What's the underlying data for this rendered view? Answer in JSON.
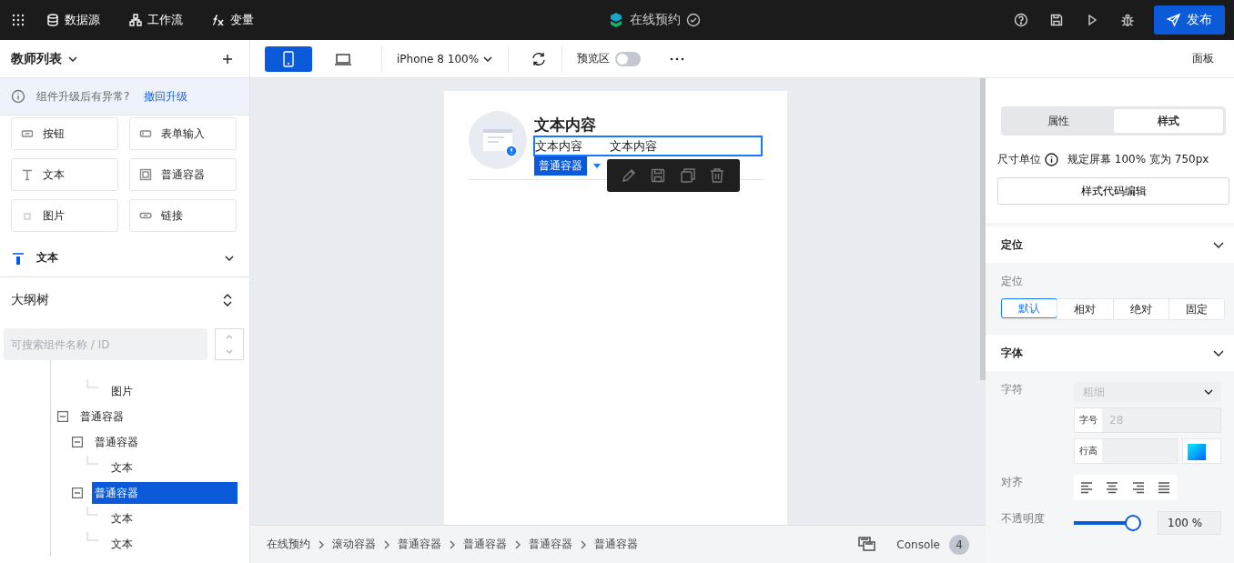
{
  "topbar": {
    "menu": [
      {
        "label": "数据源",
        "kind": "database"
      },
      {
        "label": "工作流",
        "kind": "flow"
      },
      {
        "label": "变量",
        "kind": "fx"
      }
    ],
    "app_title": "在线预约",
    "publish": "发布"
  },
  "toolbar": {
    "page_name": "教师列表",
    "devices": [
      {
        "kind": "phone",
        "selected": true
      },
      {
        "kind": "laptop",
        "selected": false
      }
    ],
    "device_select": "iPhone 8 100%",
    "preview_label": "预览区",
    "preview_on": false,
    "panel": "面板"
  },
  "left": {
    "notice": {
      "text": "组件升级后有异常?",
      "link": "撤回升级"
    },
    "components": [
      {
        "label": "按钮",
        "kind": "button"
      },
      {
        "label": "表单输入",
        "kind": "input"
      },
      {
        "label": "文本",
        "kind": "text"
      },
      {
        "label": "普通容器",
        "kind": "container"
      },
      {
        "label": "图片",
        "kind": "image"
      },
      {
        "label": "链接",
        "kind": "link"
      }
    ],
    "section": {
      "title": "文本",
      "expanded": false
    },
    "outline": {
      "title": "大纲树",
      "search_placeholder": "可搜索组件名称 / ID",
      "tree": [
        {
          "label": "图片",
          "selected": false
        },
        {
          "label": "普通容器",
          "expanded": true,
          "selected": false,
          "children": [
            {
              "label": "普通容器",
              "expanded": true,
              "selected": false,
              "children": [
                {
                  "label": "文本",
                  "selected": false
                }
              ]
            },
            {
              "label": "普通容器",
              "expanded": true,
              "selected": true,
              "children": [
                {
                  "label": "文本",
                  "selected": false
                },
                {
                  "label": "文本",
                  "selected": false
                }
              ]
            }
          ]
        }
      ]
    }
  },
  "canvas": {
    "title": "文本内容",
    "texts": [
      "文本内容",
      "文本内容"
    ],
    "tag": "普通容器"
  },
  "breadcrumb": [
    "在线预约",
    "滚动容器",
    "普通容器",
    "普通容器",
    "普通容器",
    "普通容器"
  ],
  "console": {
    "label": "Console",
    "count": "4"
  },
  "right": {
    "tabs": [
      {
        "label": "属性",
        "selected": false
      },
      {
        "label": "样式",
        "selected": true
      }
    ],
    "unit_label": "尺寸单位",
    "unit_value": "规定屏幕 100% 宽为 750px",
    "code_button": "样式代码编辑",
    "position": {
      "title": "定位",
      "label": "定位",
      "options": [
        {
          "label": "默认",
          "selected": true
        },
        {
          "label": "相对",
          "selected": false
        },
        {
          "label": "绝对",
          "selected": false
        },
        {
          "label": "固定",
          "selected": false
        }
      ]
    },
    "font": {
      "title": "字体",
      "char_label": "字符",
      "weight_placeholder": "粗细",
      "size_label": "字号",
      "size_placeholder": "28",
      "line_label": "行高",
      "align_label": "对齐",
      "opacity_label": "不透明度",
      "opacity": {
        "level": 1
      },
      "opacity_value": "100 %"
    }
  }
}
